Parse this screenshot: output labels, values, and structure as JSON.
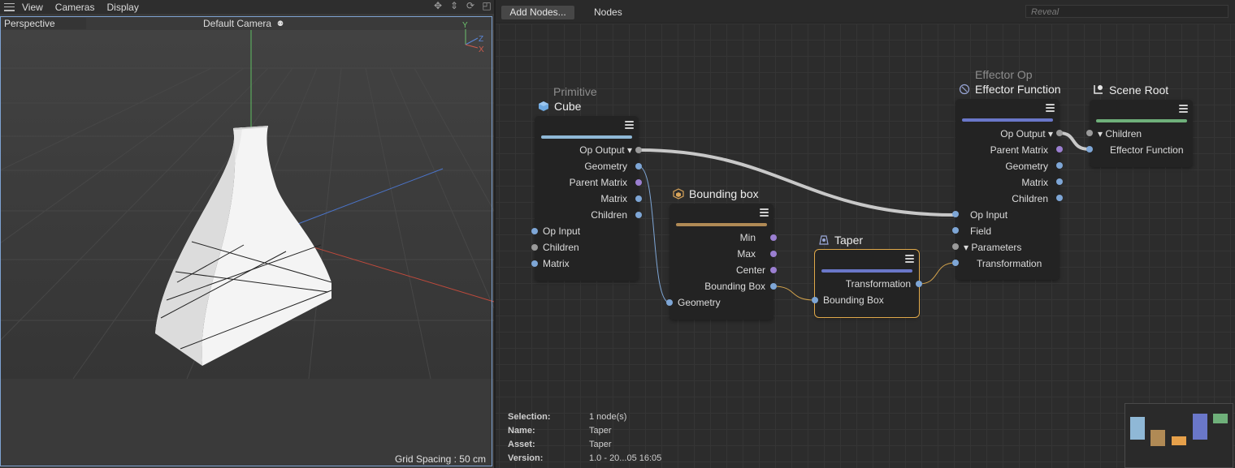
{
  "viewport": {
    "menu": [
      "View",
      "Cameras",
      "Display"
    ],
    "projection": "Perspective",
    "camera": "Default Camera",
    "axes": {
      "y": "Y",
      "z": "Z",
      "x": "X"
    },
    "grid_spacing": "Grid Spacing : 50 cm"
  },
  "editor": {
    "add_nodes": "Add Nodes...",
    "nodes_menu": "Nodes",
    "search_placeholder": "Reveal",
    "nodes": {
      "cube": {
        "subtitle": "Primitive",
        "title": "Cube",
        "accent": "#8fb8d6",
        "outputs": [
          "Op Output ▾",
          "Geometry",
          "Parent Matrix",
          "Matrix",
          "Children"
        ],
        "inputs": [
          "Op Input",
          "Children",
          "Matrix"
        ]
      },
      "bbox": {
        "title": "Bounding box",
        "accent": "#b08a55",
        "outputs": [
          "Min",
          "Max",
          "Center",
          "Bounding Box"
        ],
        "inputs": [
          "Geometry"
        ]
      },
      "taper": {
        "title": "Taper",
        "accent": "#6a77c9",
        "outputs": [
          "Transformation"
        ],
        "inputs": [
          "Bounding Box"
        ]
      },
      "effector": {
        "subtitle": "Effector Op",
        "title": "Effector Function",
        "accent": "#6a77c9",
        "outputs": [
          "Op Output ▾",
          "Parent Matrix",
          "Geometry",
          "Matrix",
          "Children"
        ],
        "inputs": [
          "Op Input",
          "Field",
          "▾ Parameters",
          "Transformation"
        ]
      },
      "scene_root": {
        "title": "Scene Root",
        "accent": "#6fb07a",
        "inputs": [
          "▾ Children",
          "Effector Function"
        ]
      }
    },
    "info": {
      "selection_label": "Selection:",
      "selection": "1 node(s)",
      "name_label": "Name:",
      "name": "Taper",
      "asset_label": "Asset:",
      "asset": "Taper",
      "version_label": "Version:",
      "version": "1.0 - 20...05 16:05"
    }
  }
}
